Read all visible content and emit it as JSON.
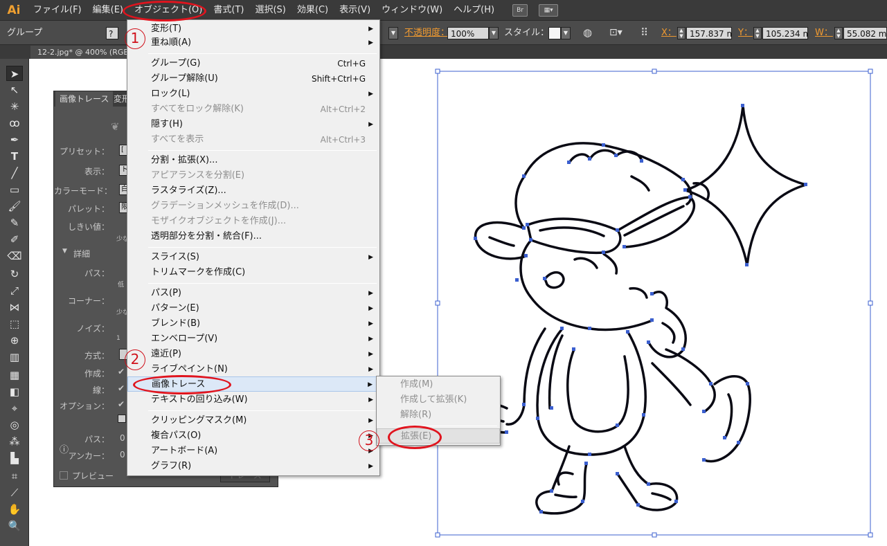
{
  "app": {
    "logo": "Ai"
  },
  "menubar": {
    "items": [
      "ファイル(F)",
      "編集(E)",
      "オブジェクト(O)",
      "書式(T)",
      "選択(S)",
      "効果(C)",
      "表示(V)",
      "ウィンドウ(W)",
      "ヘルプ(H)"
    ],
    "bridge_icon": "Br"
  },
  "controlbar": {
    "selection_label": "グループ",
    "opacity_label": "不透明度：",
    "opacity_value": "100%",
    "style_label": "スタイル：",
    "x_label": "X：",
    "x_value": "157.837 n",
    "y_label": "Y：",
    "y_value": "105.234 n",
    "w_label": "W：",
    "w_value": "55.082 m"
  },
  "doc_tab": {
    "title": "12-2.jpg* @ 400% (RGB/プ"
  },
  "trace_panel": {
    "tabs": [
      "画像トレース",
      "変形"
    ],
    "preset_label": "プリセット：",
    "display_label": "表示：",
    "colormode_label": "カラーモード：",
    "palette_label": "パレット：",
    "threshold_label": "しきい値：",
    "threshold_sub": "少な",
    "details_label": "詳細",
    "path_label": "パス：",
    "path_sub": "低",
    "corner_label": "コーナー：",
    "corner_sub": "少な",
    "noise_label": "ノイズ：",
    "noise_sub": "1",
    "method_label": "方式：",
    "create_label": "作成：",
    "stroke_label": "線：",
    "options_label": "オプション：",
    "paths_info_label": "パス：",
    "paths_info_value": "0",
    "anchors_info_label": "アンカー：",
    "anchors_info_value": "0",
    "preview_label": "プレビュー",
    "trace_button": "トレース",
    "dropdown_initials": [
      "[",
      "ト",
      "白",
      "限"
    ]
  },
  "object_menu": {
    "items": [
      {
        "label": "変形(T)",
        "shortcut": "",
        "submenu": true,
        "disabled": false
      },
      {
        "label": "重ね順(A)",
        "shortcut": "",
        "submenu": true,
        "disabled": false
      },
      {
        "label": "グループ(G)",
        "shortcut": "Ctrl+G",
        "submenu": false,
        "disabled": false
      },
      {
        "label": "グループ解除(U)",
        "shortcut": "Shift+Ctrl+G",
        "submenu": false,
        "disabled": false
      },
      {
        "label": "ロック(L)",
        "shortcut": "",
        "submenu": true,
        "disabled": false
      },
      {
        "label": "すべてをロック解除(K)",
        "shortcut": "Alt+Ctrl+2",
        "submenu": false,
        "disabled": true
      },
      {
        "label": "隠す(H)",
        "shortcut": "",
        "submenu": true,
        "disabled": false
      },
      {
        "label": "すべてを表示",
        "shortcut": "Alt+Ctrl+3",
        "submenu": false,
        "disabled": true
      },
      {
        "label": "分割・拡張(X)...",
        "shortcut": "",
        "submenu": false,
        "disabled": false
      },
      {
        "label": "アピアランスを分割(E)",
        "shortcut": "",
        "submenu": false,
        "disabled": true
      },
      {
        "label": "ラスタライズ(Z)...",
        "shortcut": "",
        "submenu": false,
        "disabled": false
      },
      {
        "label": "グラデーションメッシュを作成(D)...",
        "shortcut": "",
        "submenu": false,
        "disabled": true
      },
      {
        "label": "モザイクオブジェクトを作成(J)...",
        "shortcut": "",
        "submenu": false,
        "disabled": true
      },
      {
        "label": "透明部分を分割・統合(F)...",
        "shortcut": "",
        "submenu": false,
        "disabled": false
      },
      {
        "label": "スライス(S)",
        "shortcut": "",
        "submenu": true,
        "disabled": false
      },
      {
        "label": "トリムマークを作成(C)",
        "shortcut": "",
        "submenu": false,
        "disabled": false
      },
      {
        "label": "パス(P)",
        "shortcut": "",
        "submenu": true,
        "disabled": false
      },
      {
        "label": "パターン(E)",
        "shortcut": "",
        "submenu": true,
        "disabled": false
      },
      {
        "label": "ブレンド(B)",
        "shortcut": "",
        "submenu": true,
        "disabled": false
      },
      {
        "label": "エンベロープ(V)",
        "shortcut": "",
        "submenu": true,
        "disabled": false
      },
      {
        "label": "遠近(P)",
        "shortcut": "",
        "submenu": true,
        "disabled": false
      },
      {
        "label": "ライブペイント(N)",
        "shortcut": "",
        "submenu": true,
        "disabled": false
      },
      {
        "label": "画像トレース",
        "shortcut": "",
        "submenu": true,
        "disabled": false
      },
      {
        "label": "テキストの回り込み(W)",
        "shortcut": "",
        "submenu": true,
        "disabled": false
      },
      {
        "label": "クリッピングマスク(M)",
        "shortcut": "",
        "submenu": true,
        "disabled": false
      },
      {
        "label": "複合パス(O)",
        "shortcut": "",
        "submenu": true,
        "disabled": false
      },
      {
        "label": "アートボード(A)",
        "shortcut": "",
        "submenu": true,
        "disabled": false
      },
      {
        "label": "グラフ(R)",
        "shortcut": "",
        "submenu": true,
        "disabled": false
      }
    ]
  },
  "trace_submenu": {
    "items": [
      "作成(M)",
      "作成して拡張(K)",
      "解除(R)",
      "拡張(E)"
    ]
  },
  "annotations": {
    "n1": "1",
    "n2": "2",
    "n3": "3"
  },
  "colors": {
    "annotation_red": "#e0141e",
    "selection_blue": "#3b5fcf",
    "menubar": "#3a3a3a"
  }
}
